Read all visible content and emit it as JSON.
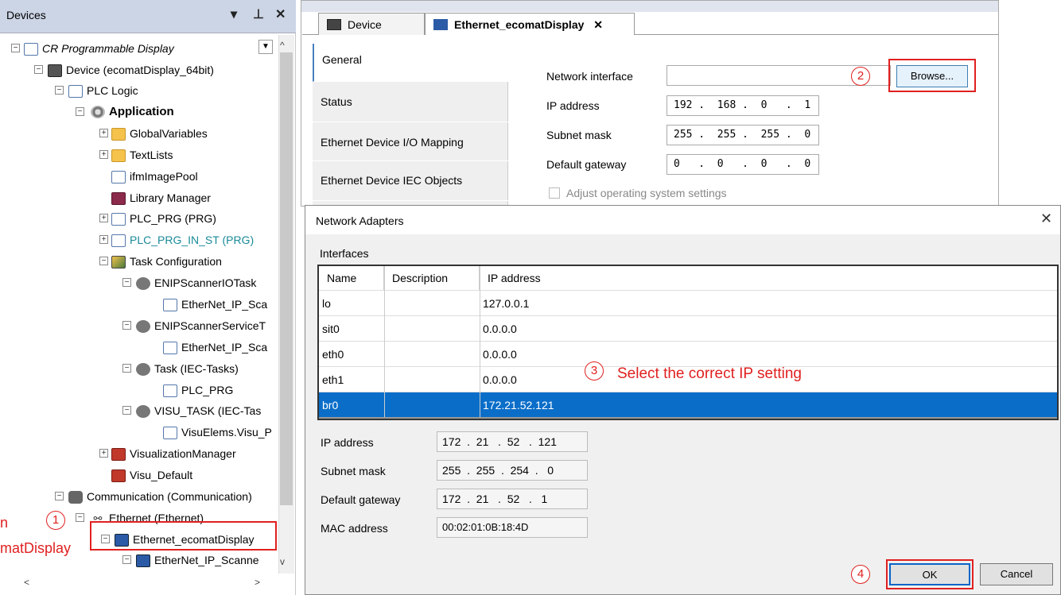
{
  "devices_panel": {
    "title": "Devices",
    "header_controls": [
      "▾",
      "⊥",
      "✕"
    ],
    "tree": [
      {
        "label": "CR Programmable Display",
        "icon": "display-icon",
        "italic": true
      },
      {
        "label": "Device (ecomatDisplay_64bit)",
        "icon": "device-icon"
      },
      {
        "label": "PLC Logic",
        "icon": "plc-logic-icon"
      },
      {
        "label": "Application",
        "icon": "application-icon",
        "bold": true
      },
      {
        "label": "GlobalVariables",
        "icon": "folder-icon"
      },
      {
        "label": "TextLists",
        "icon": "folder-icon"
      },
      {
        "label": "ifmImagePool",
        "icon": "image-pool-icon"
      },
      {
        "label": "Library Manager",
        "icon": "library-icon"
      },
      {
        "label": "PLC_PRG (PRG)",
        "icon": "program-icon"
      },
      {
        "label": "PLC_PRG_IN_ST (PRG)",
        "icon": "program-icon",
        "color": "#1a8a9a"
      },
      {
        "label": "Task Configuration",
        "icon": "task-config-icon"
      },
      {
        "label": "ENIPScannerIOTask",
        "icon": "task-icon"
      },
      {
        "label": "EtherNet_IP_Sca",
        "icon": "call-icon"
      },
      {
        "label": "ENIPScannerServiceT",
        "icon": "task-icon"
      },
      {
        "label": "EtherNet_IP_Sca",
        "icon": "call-icon"
      },
      {
        "label": "Task (IEC-Tasks)",
        "icon": "task-icon"
      },
      {
        "label": "PLC_PRG",
        "icon": "call-icon"
      },
      {
        "label": "VISU_TASK (IEC-Tas",
        "icon": "task-icon"
      },
      {
        "label": "VisuElems.Visu_P",
        "icon": "call-icon"
      },
      {
        "label": "VisualizationManager",
        "icon": "visu-manager-icon"
      },
      {
        "label": "Visu_Default",
        "icon": "visu-icon"
      },
      {
        "label": "Communication (Communication)",
        "icon": "communication-icon"
      },
      {
        "label": "Ethernet (Ethernet)",
        "icon": "network-icon"
      },
      {
        "label": "Ethernet_ecomatDisplay",
        "icon": "ethernet-device-icon"
      },
      {
        "label": "EtherNet_IP_Scanne",
        "icon": "ethernet-device-icon"
      }
    ],
    "left_edge_fragments": [
      "n",
      "matDisplay"
    ]
  },
  "editor": {
    "tabs": [
      {
        "label": "Device",
        "active": false
      },
      {
        "label": "Ethernet_ecomatDisplay",
        "active": true
      }
    ],
    "tab_close": "✕",
    "sidenav": [
      "General",
      "Status",
      "Ethernet Device I/O Mapping",
      "Ethernet Device IEC Objects"
    ],
    "fields": {
      "network_interface_label": "Network interface",
      "network_interface_value": "",
      "ip_label": "IP address",
      "ip_value": "192 .  168 .  0   .  1",
      "subnet_label": "Subnet mask",
      "subnet_value": "255 .  255 .  255 .  0",
      "gateway_label": "Default gateway",
      "gateway_value": "0   .  0   .  0   .  0",
      "adjust_label": "Adjust operating system settings"
    },
    "browse_label": "Browse..."
  },
  "dialog": {
    "title": "Network Adapters",
    "close": "✕",
    "group_label": "Interfaces",
    "columns": [
      "Name",
      "Description",
      "IP address"
    ],
    "rows": [
      {
        "name": "lo",
        "description": "",
        "ip": "127.0.0.1"
      },
      {
        "name": "sit0",
        "description": "",
        "ip": "0.0.0.0"
      },
      {
        "name": "eth0",
        "description": "",
        "ip": "0.0.0.0"
      },
      {
        "name": "eth1",
        "description": "",
        "ip": "0.0.0.0"
      },
      {
        "name": "br0",
        "description": "",
        "ip": "172.21.52.121",
        "selected": true
      }
    ],
    "ip_label": "IP address",
    "ip_value": "172  .  21   .  52   .  121",
    "subnet_label": "Subnet mask",
    "subnet_value": "255  .  255  .  254  .   0",
    "gateway_label": "Default gateway",
    "gateway_value": "172  .  21   .  52   .   1",
    "mac_label": "MAC address",
    "mac_value": "00:02:01:0B:18:4D",
    "ok_label": "OK",
    "cancel_label": "Cancel"
  },
  "annotations": {
    "step1": "1",
    "step2": "2",
    "step3": "3",
    "step4": "4",
    "step3_text": "Select the correct IP setting",
    "accent_color": "#e02020"
  }
}
